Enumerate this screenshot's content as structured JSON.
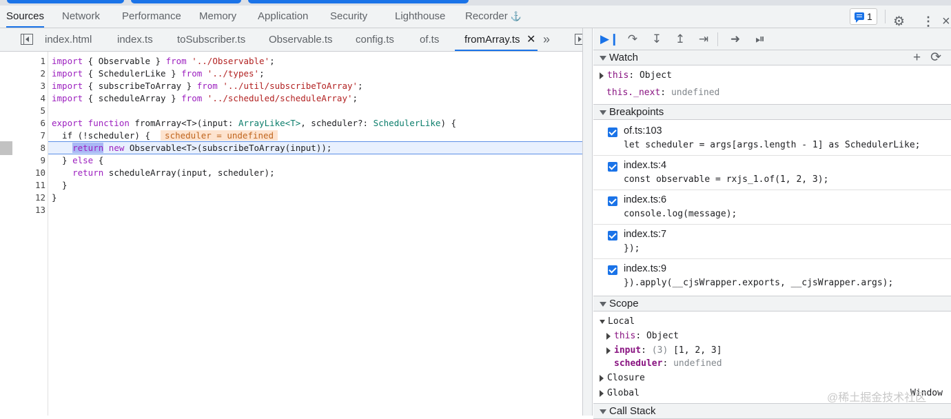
{
  "colors": {
    "accent": "#1a73e8",
    "keyword": "#9c1fbf",
    "string": "#b22222",
    "type": "#0b7d6b",
    "current_line": "#e8f0fe"
  },
  "main_tabs": [
    "Sources",
    "Network",
    "Performance",
    "Memory",
    "Application",
    "Security",
    "Lighthouse",
    "Recorder"
  ],
  "issues_count": "1",
  "file_tabs": [
    "index.html",
    "index.ts",
    "toSubscriber.ts",
    "Observable.ts",
    "config.ts",
    "of.ts",
    "fromArray.ts"
  ],
  "editor": {
    "line_numbers": [
      "1",
      "2",
      "3",
      "4",
      "5",
      "6",
      "7",
      "8",
      "9",
      "10",
      "11",
      "12",
      "13"
    ],
    "lines": {
      "l1_kw": "import",
      "l1_a": " { Observable } ",
      "l1_from": "from",
      "l1_str": " '../Observable'",
      "l1_end": ";",
      "l2_kw": "import",
      "l2_a": " { SchedulerLike } ",
      "l2_from": "from",
      "l2_str": " '../types'",
      "l2_end": ";",
      "l3_kw": "import",
      "l3_a": " { subscribeToArray } ",
      "l3_from": "from",
      "l3_str": " '../util/subscribeToArray'",
      "l3_end": ";",
      "l4_kw": "import",
      "l4_a": " { scheduleArray } ",
      "l4_from": "from",
      "l4_str": " '../scheduled/scheduleArray'",
      "l4_end": ";",
      "l6_kw1": "export",
      "l6_kw2": " function",
      "l6_a": " fromArray<T>(input: ",
      "l6_ty1": "ArrayLike<T>",
      "l6_b": ", scheduler?: ",
      "l6_ty2": "SchedulerLike",
      "l6_c": ") {",
      "l7_a": "  if (!scheduler) {  ",
      "l7_inline": "scheduler = undefined",
      "l8_ind": "    ",
      "l8_ret": "return",
      "l8_kw": " new",
      "l8_a": " Observable<T>(subscribeToArray(input));",
      "l9_a": "  } ",
      "l9_kw": "else",
      "l9_b": " {",
      "l10_ind": "    ",
      "l10_kw": "return",
      "l10_a": " scheduleArray(input, scheduler);",
      "l11_a": "  }",
      "l12_a": "}"
    }
  },
  "watch": {
    "title": "Watch",
    "add": "+",
    "refresh": "⟳",
    "items": [
      {
        "name": "this",
        "value": "Object"
      },
      {
        "name": "this._next",
        "value": "undefined"
      }
    ]
  },
  "breakpoints": {
    "title": "Breakpoints",
    "items": [
      {
        "location": "of.ts:103",
        "code": "let scheduler = args[args.length - 1] as SchedulerLike;"
      },
      {
        "location": "index.ts:4",
        "code": "const observable = rxjs_1.of(1, 2, 3);"
      },
      {
        "location": "index.ts:6",
        "code": "console.log(message);"
      },
      {
        "location": "index.ts:7",
        "code": "});"
      },
      {
        "location": "index.ts:9",
        "code": "}).apply(__cjsWrapper.exports, __cjsWrapper.args);"
      }
    ]
  },
  "scope": {
    "title": "Scope",
    "local": "Local",
    "this_name": "this",
    "this_value": "Object",
    "input_name": "input",
    "input_count": "(3)",
    "input_value": "[1, 2, 3]",
    "scheduler_name": "scheduler",
    "scheduler_value": "undefined",
    "closure": "Closure",
    "global": "Global",
    "global_value": "Window"
  },
  "call_stack": {
    "title": "Call Stack"
  },
  "watermark": "@稀土掘金技术社区"
}
